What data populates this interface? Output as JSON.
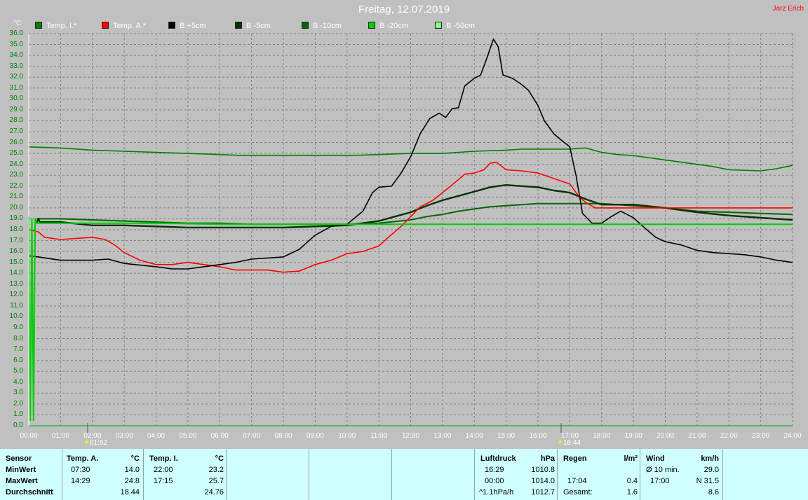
{
  "title": "Freitag, 12.07.2019",
  "author": "Jarz Erich",
  "colors": {
    "background": "#c0c0c0",
    "axis_text": "#008000",
    "table_bg": "#cfffff",
    "temp_i": "#008000",
    "temp_a": "#ff0000",
    "b5": "#000000",
    "b_5": "#003300",
    "b_10": "#006600",
    "b_20": "#00cc00",
    "b_50": "#88ff88"
  },
  "chart_data": {
    "type": "line",
    "title": "Freitag, 12.07.2019",
    "ylabel": "°C",
    "ylim": [
      0,
      36
    ],
    "xlim": [
      0,
      24
    ],
    "grid": true,
    "legend_placement": "top",
    "y_ticks": [
      "0.0",
      "1.0",
      "2.0",
      "3.0",
      "4.0",
      "5.0",
      "6.0",
      "7.0",
      "8.0",
      "9.0",
      "10.0",
      "11.0",
      "12.0",
      "13.0",
      "14.0",
      "15.0",
      "16.0",
      "17.0",
      "18.0",
      "19.0",
      "20.0",
      "21.0",
      "22.0",
      "23.0",
      "24.0",
      "25.0",
      "26.0",
      "27.0",
      "28.0",
      "29.0",
      "30.0",
      "31.0",
      "32.0",
      "33.0",
      "34.0",
      "35.0",
      "36.0"
    ],
    "x_ticks": [
      "00:00",
      "01:00",
      "02:00",
      "03:00",
      "04:00",
      "05:00",
      "06:00",
      "07:00",
      "08:00",
      "09:00",
      "10:00",
      "11:00",
      "12:00",
      "13:00",
      "14:00",
      "15:00",
      "16:00",
      "17:00",
      "18:00",
      "19:00",
      "20:00",
      "21:00",
      "22:00",
      "23:00",
      "24:00"
    ],
    "sunrise": "01:52",
    "sunset": "16:44",
    "series": [
      {
        "name": "Temp. I.*",
        "color": "#008000",
        "width": 1.6,
        "points": [
          [
            0,
            25.6
          ],
          [
            1,
            25.5
          ],
          [
            2,
            25.3
          ],
          [
            3,
            25.2
          ],
          [
            4,
            25.1
          ],
          [
            5,
            25.0
          ],
          [
            6,
            24.9
          ],
          [
            6.8,
            24.8
          ],
          [
            8,
            24.8
          ],
          [
            9,
            24.8
          ],
          [
            10,
            24.8
          ],
          [
            11,
            24.9
          ],
          [
            12,
            25.0
          ],
          [
            13,
            25.0
          ],
          [
            14,
            25.2
          ],
          [
            15,
            25.3
          ],
          [
            15.5,
            25.4
          ],
          [
            16,
            25.4
          ],
          [
            16.5,
            25.4
          ],
          [
            17,
            25.4
          ],
          [
            17.5,
            25.5
          ],
          [
            18,
            25.1
          ],
          [
            18.5,
            24.9
          ],
          [
            19,
            24.8
          ],
          [
            20,
            24.4
          ],
          [
            21,
            24.0
          ],
          [
            21.5,
            23.8
          ],
          [
            22,
            23.5
          ],
          [
            23,
            23.4
          ],
          [
            23.5,
            23.6
          ],
          [
            24,
            23.9
          ]
        ]
      },
      {
        "name": "Temp. A.*",
        "color": "#ff0000",
        "width": 1.6,
        "points": [
          [
            0,
            18.0
          ],
          [
            0.3,
            17.8
          ],
          [
            0.5,
            17.3
          ],
          [
            1,
            17.1
          ],
          [
            1.5,
            17.2
          ],
          [
            2,
            17.3
          ],
          [
            2.4,
            17.1
          ],
          [
            2.7,
            16.6
          ],
          [
            3,
            15.9
          ],
          [
            3.5,
            15.2
          ],
          [
            4,
            14.8
          ],
          [
            4.5,
            14.8
          ],
          [
            5,
            15.0
          ],
          [
            5.5,
            14.8
          ],
          [
            6,
            14.6
          ],
          [
            6.5,
            14.3
          ],
          [
            7,
            14.3
          ],
          [
            7.5,
            14.3
          ],
          [
            8,
            14.1
          ],
          [
            8.5,
            14.2
          ],
          [
            9,
            14.8
          ],
          [
            9.5,
            15.2
          ],
          [
            10,
            15.8
          ],
          [
            10.5,
            16.0
          ],
          [
            11,
            16.5
          ],
          [
            11.3,
            17.3
          ],
          [
            11.7,
            18.3
          ],
          [
            12,
            19.2
          ],
          [
            12.3,
            20.1
          ],
          [
            12.7,
            20.7
          ],
          [
            13,
            21.4
          ],
          [
            13.3,
            22.1
          ],
          [
            13.7,
            23.1
          ],
          [
            14,
            23.2
          ],
          [
            14.3,
            23.5
          ],
          [
            14.5,
            24.1
          ],
          [
            14.7,
            24.2
          ],
          [
            15,
            23.5
          ],
          [
            15.5,
            23.4
          ],
          [
            16,
            23.2
          ],
          [
            16.5,
            22.7
          ],
          [
            17,
            22.2
          ],
          [
            17.3,
            21.0
          ],
          [
            17.5,
            20.5
          ],
          [
            17.8,
            20.0
          ],
          [
            18,
            20.0
          ],
          [
            18.5,
            20.0
          ],
          [
            19,
            20.0
          ],
          [
            19.5,
            20.0
          ],
          [
            20,
            20.0
          ],
          [
            21,
            20.0
          ],
          [
            22,
            20.0
          ],
          [
            23,
            20.0
          ],
          [
            24,
            20.0
          ]
        ]
      },
      {
        "name": "B +5cm",
        "color": "#000000",
        "width": 1.6,
        "points": [
          [
            0,
            15.6
          ],
          [
            0.3,
            15.5
          ],
          [
            1,
            15.2
          ],
          [
            2,
            15.2
          ],
          [
            2.5,
            15.3
          ],
          [
            3,
            14.9
          ],
          [
            4,
            14.6
          ],
          [
            4.5,
            14.4
          ],
          [
            5,
            14.4
          ],
          [
            5.5,
            14.6
          ],
          [
            6,
            14.8
          ],
          [
            6.5,
            15.0
          ],
          [
            7,
            15.3
          ],
          [
            7.5,
            15.4
          ],
          [
            8,
            15.5
          ],
          [
            8.5,
            16.2
          ],
          [
            9,
            17.5
          ],
          [
            9.5,
            18.3
          ],
          [
            10,
            18.5
          ],
          [
            10.5,
            19.7
          ],
          [
            10.8,
            21.4
          ],
          [
            11,
            21.9
          ],
          [
            11.4,
            22.0
          ],
          [
            11.7,
            23.2
          ],
          [
            12,
            24.7
          ],
          [
            12.3,
            26.8
          ],
          [
            12.6,
            28.2
          ],
          [
            12.9,
            28.7
          ],
          [
            13.1,
            28.3
          ],
          [
            13.3,
            29.1
          ],
          [
            13.5,
            29.2
          ],
          [
            13.7,
            31.2
          ],
          [
            14,
            31.9
          ],
          [
            14.2,
            32.2
          ],
          [
            14.4,
            33.8
          ],
          [
            14.6,
            35.5
          ],
          [
            14.75,
            34.8
          ],
          [
            14.9,
            32.2
          ],
          [
            15.2,
            31.9
          ],
          [
            15.5,
            31.3
          ],
          [
            15.7,
            30.8
          ],
          [
            16,
            29.4
          ],
          [
            16.2,
            28.0
          ],
          [
            16.5,
            26.8
          ],
          [
            16.7,
            26.3
          ],
          [
            17,
            25.6
          ],
          [
            17.2,
            22.9
          ],
          [
            17.4,
            19.5
          ],
          [
            17.7,
            18.6
          ],
          [
            18,
            18.6
          ],
          [
            18.3,
            19.2
          ],
          [
            18.6,
            19.7
          ],
          [
            19,
            19.1
          ],
          [
            19.3,
            18.3
          ],
          [
            19.7,
            17.3
          ],
          [
            20,
            16.9
          ],
          [
            20.5,
            16.6
          ],
          [
            21,
            16.1
          ],
          [
            21.5,
            15.9
          ],
          [
            22,
            15.8
          ],
          [
            22.5,
            15.7
          ],
          [
            23,
            15.5
          ],
          [
            23.5,
            15.2
          ],
          [
            24,
            15.0
          ]
        ]
      },
      {
        "name": "B -5cm",
        "color": "#003300",
        "width": 2.4,
        "points": [
          [
            0.25,
            18.6
          ],
          [
            0.3,
            19.0
          ],
          [
            0.35,
            18.7
          ],
          [
            1,
            18.7
          ],
          [
            2,
            18.4
          ],
          [
            3,
            18.4
          ],
          [
            4,
            18.3
          ],
          [
            5,
            18.2
          ],
          [
            6,
            18.2
          ],
          [
            7,
            18.2
          ],
          [
            8,
            18.2
          ],
          [
            9,
            18.3
          ],
          [
            10,
            18.4
          ],
          [
            10.5,
            18.6
          ],
          [
            11,
            18.8
          ],
          [
            11.5,
            19.2
          ],
          [
            12,
            19.6
          ],
          [
            12.5,
            20.2
          ],
          [
            13,
            20.7
          ],
          [
            13.5,
            21.1
          ],
          [
            14,
            21.5
          ],
          [
            14.5,
            21.9
          ],
          [
            15,
            22.1
          ],
          [
            15.5,
            22.0
          ],
          [
            16,
            21.9
          ],
          [
            16.5,
            21.6
          ],
          [
            17,
            21.4
          ],
          [
            17.5,
            20.8
          ],
          [
            18,
            20.3
          ],
          [
            19,
            20.3
          ],
          [
            20,
            20.0
          ],
          [
            21,
            19.6
          ],
          [
            22,
            19.3
          ],
          [
            23,
            19.1
          ],
          [
            24,
            18.9
          ]
        ]
      },
      {
        "name": "B -10cm",
        "color": "#006600",
        "width": 2.0,
        "points": [
          [
            0.25,
            19.0
          ],
          [
            1,
            19.0
          ],
          [
            2,
            18.9
          ],
          [
            3,
            18.8
          ],
          [
            4,
            18.7
          ],
          [
            5,
            18.6
          ],
          [
            6,
            18.6
          ],
          [
            7,
            18.5
          ],
          [
            8,
            18.5
          ],
          [
            9,
            18.5
          ],
          [
            10,
            18.5
          ],
          [
            11,
            18.6
          ],
          [
            12,
            18.9
          ],
          [
            12.5,
            19.2
          ],
          [
            13,
            19.4
          ],
          [
            13.5,
            19.7
          ],
          [
            14,
            19.9
          ],
          [
            14.5,
            20.1
          ],
          [
            15,
            20.2
          ],
          [
            15.5,
            20.3
          ],
          [
            16,
            20.4
          ],
          [
            17,
            20.4
          ],
          [
            17.5,
            20.4
          ],
          [
            18,
            20.4
          ],
          [
            19,
            20.2
          ],
          [
            20,
            20.0
          ],
          [
            21,
            19.7
          ],
          [
            22,
            19.6
          ],
          [
            23,
            19.5
          ],
          [
            24,
            19.4
          ]
        ]
      },
      {
        "name": "B -20cm",
        "color": "#00cc00",
        "width": 2.0,
        "points": [
          [
            0,
            19.2
          ],
          [
            0.05,
            0.5
          ],
          [
            0.1,
            19.0
          ],
          [
            0.15,
            0.5
          ],
          [
            0.2,
            19.0
          ],
          [
            0.25,
            18.6
          ],
          [
            1,
            18.6
          ],
          [
            2,
            18.6
          ],
          [
            4,
            18.6
          ],
          [
            6,
            18.5
          ],
          [
            8,
            18.5
          ],
          [
            10,
            18.5
          ],
          [
            12,
            18.5
          ],
          [
            14,
            18.5
          ],
          [
            16,
            18.5
          ],
          [
            18,
            18.5
          ],
          [
            20,
            18.5
          ],
          [
            22,
            18.5
          ],
          [
            24,
            18.5
          ]
        ]
      },
      {
        "name": "B -50cm",
        "color": "#88ff88",
        "width": 1.2,
        "points": []
      }
    ]
  },
  "table": {
    "col1": {
      "header": "Sensor",
      "rows": [
        "MinWert",
        "MaxWert",
        "Durchschnitt"
      ]
    },
    "col2": {
      "header": "Temp. A.",
      "unit": "°C",
      "times": [
        "07:30",
        "14:29",
        ""
      ],
      "values": [
        "14.0",
        "24.8",
        "18.44"
      ]
    },
    "col3": {
      "header": "Temp. I.",
      "unit": "°C",
      "times": [
        "22:00",
        "17:15",
        ""
      ],
      "values": [
        "23.2",
        "25.7",
        "24.76"
      ]
    },
    "col_pressure": {
      "header": "Luftdruck",
      "unit": "hPa",
      "times": [
        "16:29",
        "00:00",
        "^1.1hPa/h"
      ],
      "values": [
        "1010.8",
        "1014.0",
        "1012.7"
      ]
    },
    "col_rain": {
      "header": "Regen",
      "unit": "l/m²",
      "times": [
        "",
        "17:04",
        "Gesamt:"
      ],
      "values": [
        "",
        "0.4",
        "1.6"
      ]
    },
    "col_wind": {
      "header": "Wind",
      "unit": "km/h",
      "times": [
        "Ø 10 min.",
        "17:00",
        ""
      ],
      "values": [
        "29.0",
        "N 31.5",
        "8.6"
      ]
    }
  }
}
